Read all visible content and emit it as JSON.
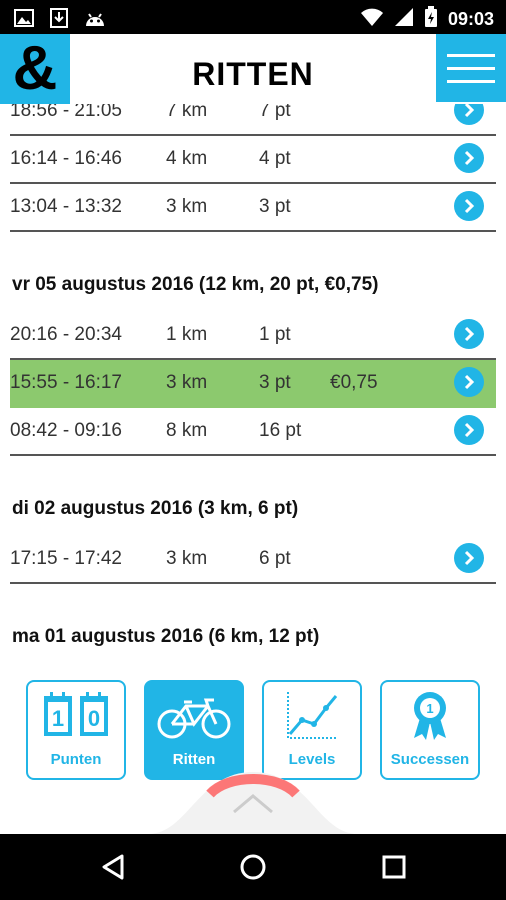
{
  "status": {
    "time": "09:03"
  },
  "header": {
    "title": "RITTEN",
    "logo": "&"
  },
  "rows_top": [
    {
      "time": "18:56 - 21:05",
      "km": "7 km",
      "pt": "7 pt",
      "eur": ""
    },
    {
      "time": "16:14 - 16:46",
      "km": "4 km",
      "pt": "4 pt",
      "eur": ""
    },
    {
      "time": "13:04 - 13:32",
      "km": "3 km",
      "pt": "3 pt",
      "eur": ""
    }
  ],
  "day1": {
    "header": "vr 05 augustus 2016 (12 km, 20 pt, €0,75)",
    "rows": [
      {
        "time": "20:16 - 20:34",
        "km": "1 km",
        "pt": "1 pt",
        "eur": ""
      },
      {
        "time": "15:55 - 16:17",
        "km": "3 km",
        "pt": "3 pt",
        "eur": "€0,75"
      },
      {
        "time": "08:42 - 09:16",
        "km": "8 km",
        "pt": "16 pt",
        "eur": ""
      }
    ]
  },
  "day2": {
    "header": "di 02 augustus 2016 (3 km, 6 pt)",
    "rows": [
      {
        "time": "17:15 - 17:42",
        "km": "3 km",
        "pt": "6 pt",
        "eur": ""
      }
    ]
  },
  "day3": {
    "header": "ma 01 augustus 2016 (6 km, 12 pt)"
  },
  "nav": {
    "punten": "Punten",
    "ritten": "Ritten",
    "levels": "Levels",
    "successen": "Successen",
    "punten_digits": [
      "1",
      "0"
    ],
    "badge_number": "1"
  },
  "colors": {
    "accent": "#21b5e6",
    "highlight": "#8cc96e"
  }
}
